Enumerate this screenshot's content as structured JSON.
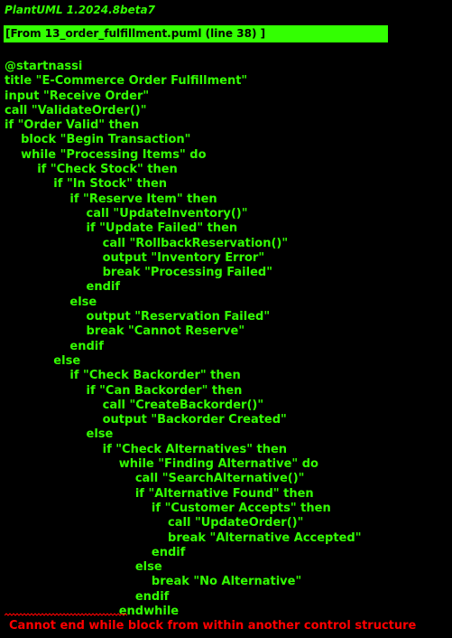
{
  "header": {
    "version": "PlantUML 1.2024.8beta7",
    "source": "[From 13_order_fulfillment.puml (line 38) ]"
  },
  "code_lines": [
    "@startnassi",
    "title \"E-Commerce Order Fulfillment\"",
    "input \"Receive Order\"",
    "call \"ValidateOrder()\"",
    "if \"Order Valid\" then",
    "    block \"Begin Transaction\"",
    "    while \"Processing Items\" do",
    "        if \"Check Stock\" then",
    "            if \"In Stock\" then",
    "                if \"Reserve Item\" then",
    "                    call \"UpdateInventory()\"",
    "                    if \"Update Failed\" then",
    "                        call \"RollbackReservation()\"",
    "                        output \"Inventory Error\"",
    "                        break \"Processing Failed\"",
    "                    endif",
    "                else",
    "                    output \"Reservation Failed\"",
    "                    break \"Cannot Reserve\"",
    "                endif",
    "            else",
    "                if \"Check Backorder\" then",
    "                    if \"Can Backorder\" then",
    "                        call \"CreateBackorder()\"",
    "                        output \"Backorder Created\"",
    "                    else",
    "                        if \"Check Alternatives\" then",
    "                            while \"Finding Alternative\" do",
    "                                call \"SearchAlternative()\"",
    "                                if \"Alternative Found\" then",
    "                                    if \"Customer Accepts\" then",
    "                                        call \"UpdateOrder()\"",
    "                                        break \"Alternative Accepted\"",
    "                                    endif",
    "                                else",
    "                                    break \"No Alternative\"",
    "                                endif",
    "                            endwhile"
  ],
  "error": {
    "message": "Cannot end while block from within another control structure",
    "color": "#ff0000"
  },
  "colors": {
    "text": "#33ff02",
    "banner": "#33ff02",
    "background": "#000000"
  }
}
